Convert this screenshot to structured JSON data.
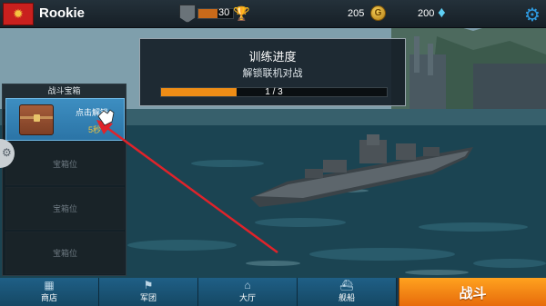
{
  "topbar": {
    "player_name": "Rookie",
    "rank_value": "30",
    "rank_progress": 0.55,
    "gold": "205",
    "gems": "200",
    "icons": {
      "avatar": "dragon-emblem-icon",
      "rank": "rank-shield-icon",
      "trophy": "trophy-icon",
      "coin": "gold-coin-icon",
      "gem": "diamond-icon",
      "settings": "gear-icon"
    }
  },
  "training": {
    "title": "训练进度",
    "subtitle": "解锁联机对战",
    "progress_text": "1 / 3",
    "progress": 0.333
  },
  "chest_panel": {
    "header": "战斗宝箱",
    "active_slot": {
      "action_label": "点击解锁",
      "time_label": "5秒"
    },
    "empty_slots": [
      {
        "label": "宝箱位"
      },
      {
        "label": "宝箱位"
      },
      {
        "label": "宝箱位"
      }
    ]
  },
  "nav": {
    "items": [
      {
        "label": "商店",
        "icon": "store-icon"
      },
      {
        "label": "军团",
        "icon": "legion-icon"
      },
      {
        "label": "大厅",
        "icon": "lobby-icon"
      },
      {
        "label": "舰船",
        "icon": "ship-icon"
      }
    ],
    "battle_label": "战斗"
  },
  "colors": {
    "accent_orange": "#ee8d16",
    "battle_button": "#f18a17",
    "nav_blue": "#1f5f86",
    "annotation_red": "#e0232a"
  }
}
